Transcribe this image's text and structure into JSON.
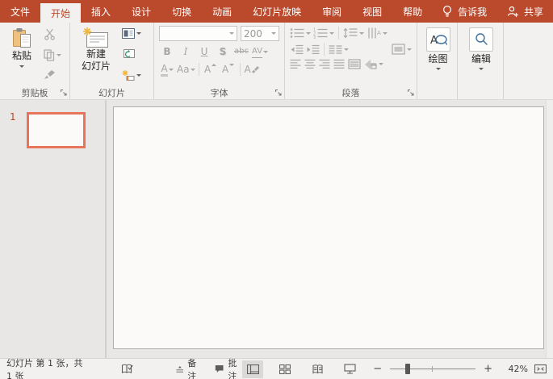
{
  "colors": {
    "ribbon_red": "#BB4A2D",
    "active_tab_text": "#BB4A2D",
    "slide_selection_border": "#E8745A",
    "disabled_icon_gray": "#ACAAA8",
    "enabled_icon_blue": "#41719C",
    "paste_clipboard_tan": "#EEC17E",
    "star_yellow": "#F0B73F"
  },
  "tabbar": {
    "tabs": [
      {
        "label": "文件"
      },
      {
        "label": "开始"
      },
      {
        "label": "插入"
      },
      {
        "label": "设计"
      },
      {
        "label": "切换"
      },
      {
        "label": "动画"
      },
      {
        "label": "幻灯片放映"
      },
      {
        "label": "审阅"
      },
      {
        "label": "视图"
      },
      {
        "label": "帮助"
      }
    ],
    "tell_me": "告诉我",
    "share": "共享"
  },
  "ribbon": {
    "clipboard": {
      "label": "剪贴板",
      "paste_label": "粘贴"
    },
    "slides": {
      "label": "幻灯片",
      "new_slide_line1": "新建",
      "new_slide_line2": "幻灯片"
    },
    "font": {
      "label": "字体",
      "font_name_value": "",
      "font_size_value": "200",
      "bold_glyph": "B",
      "italic_glyph": "I",
      "underline_glyph": "U",
      "shadow_glyph": "S",
      "strikethrough_glyph": "abc",
      "spacing_glyph": "AV",
      "font_color_glyph": "A",
      "change_case_glyph": "Aa",
      "grow_font_glyph": "A",
      "shrink_font_glyph": "A",
      "clear_format_glyph": "A"
    },
    "paragraph": {
      "label": "段落"
    },
    "drawing": {
      "label": "绘图",
      "icon_letter": "A"
    },
    "editing": {
      "label": "编辑"
    }
  },
  "slides_panel": {
    "slide_number": "1"
  },
  "status_bar": {
    "slide_info": "幻灯片 第 1 张，共 1 张",
    "notes_label": "备注",
    "comments_label": "批注",
    "zoom_out_glyph": "−",
    "zoom_in_glyph": "+",
    "zoom_percent": "42%"
  }
}
